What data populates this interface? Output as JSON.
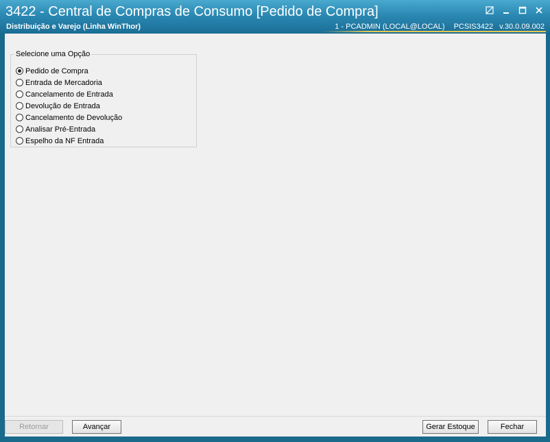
{
  "window": {
    "title": "3422 - Central de Compras de Consumo [Pedido de Compra]",
    "subtitle": "Distribuição e Varejo (Linha WinThor)",
    "user_info": "1 - PCADMIN (LOCAL@LOCAL)",
    "program": "PCSIS3422",
    "version": "v.30.0.09.002"
  },
  "group": {
    "legend": "Selecione uma Opção",
    "options": [
      {
        "label": "Pedido de Compra",
        "selected": true
      },
      {
        "label": "Entrada de Mercadoria",
        "selected": false
      },
      {
        "label": "Cancelamento de Entrada",
        "selected": false
      },
      {
        "label": "Devolução de Entrada",
        "selected": false
      },
      {
        "label": "Cancelamento de Devolução",
        "selected": false
      },
      {
        "label": "Analisar Pré-Entrada",
        "selected": false
      },
      {
        "label": "Espelho da NF Entrada",
        "selected": false
      }
    ]
  },
  "footer": {
    "back_label": "Retornar",
    "next_label": "Avançar",
    "stock_label": "Gerar Estoque",
    "close_label": "Fechar"
  },
  "colors": {
    "titlebar": "#2b89b3",
    "client_bg": "#f0f0f0"
  }
}
